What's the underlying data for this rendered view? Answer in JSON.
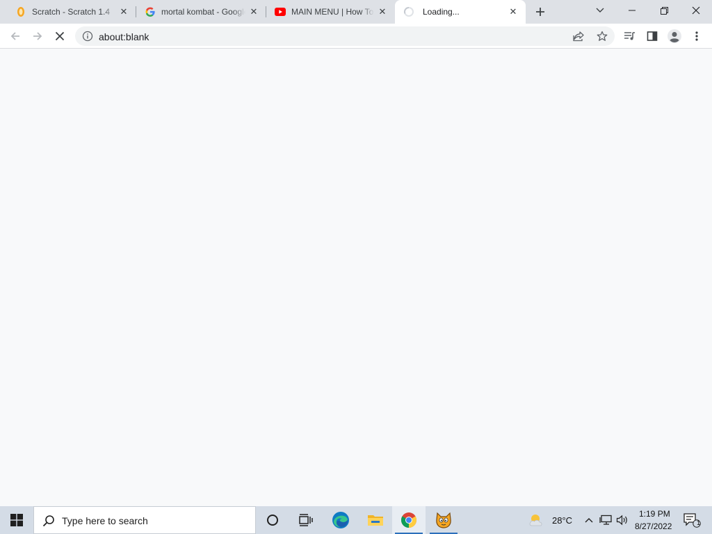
{
  "browser": {
    "tabs": [
      {
        "title": "Scratch - Scratch 1.4",
        "favicon": "scratch-cat-icon",
        "active": false
      },
      {
        "title": "mortal kombat - Google Search",
        "favicon": "google-g-icon",
        "active": false
      },
      {
        "title": "MAIN MENU | How To Make a Fighting Game",
        "favicon": "youtube-icon",
        "active": false
      },
      {
        "title": "Loading...",
        "favicon": "loading-spinner-icon",
        "active": true
      }
    ],
    "address": "about:blank",
    "colors": {
      "tabstrip": "#dee1e6",
      "toolbar": "#ffffff",
      "content": "#f8f9fa",
      "youtube_red": "#ff0000"
    }
  },
  "taskbar": {
    "search_placeholder": "Type here to search",
    "weather": "28°C",
    "time": "1:19 PM",
    "date": "8/27/2022",
    "notification_count": "1",
    "pinned": [
      "task-view-icon",
      "edge-icon",
      "file-explorer-icon",
      "chrome-icon",
      "scratch-icon"
    ]
  }
}
